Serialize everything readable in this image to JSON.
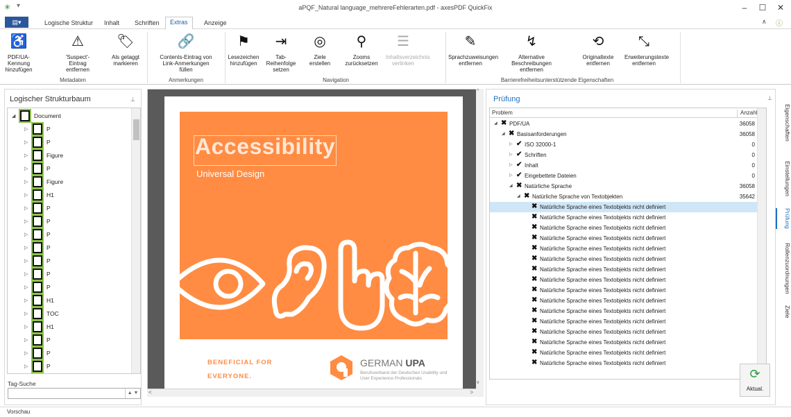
{
  "window": {
    "title": "aPQF_Natural language_mehrereFehlerarten.pdf - axesPDF QuickFix",
    "minimize": "–",
    "maximize": "☐",
    "close": "✕"
  },
  "ribbon_tabs": {
    "file": "▤▾",
    "items": [
      "Logische Struktur",
      "Inhalt",
      "Schriften",
      "Extras",
      "Anzeige"
    ],
    "active": "Extras"
  },
  "ribbon": {
    "buttons": [
      {
        "label": "PDF/UA-Kennung hinzufügen",
        "icon": "accessibility-icon"
      },
      {
        "label": "'Suspect'-Eintrag entfernen",
        "icon": "suspect-remove-icon"
      },
      {
        "label": "Als getaggt markieren",
        "icon": "tag-mark-icon"
      },
      {
        "label": "Contents-Eintrag von Link-Anmerkungen füllen",
        "icon": "link-icon"
      },
      {
        "label": "Lesezeichen hinzufügen",
        "icon": "bookmark-icon"
      },
      {
        "label": "Tab-Reihenfolge setzen",
        "icon": "tab-order-icon"
      },
      {
        "label": "Ziele erstellen",
        "icon": "target-icon"
      },
      {
        "label": "Zooms zurücksetzen",
        "icon": "zoom-icon"
      },
      {
        "label": "Inhaltsverzeichnis verlinken",
        "icon": "toc-link-icon",
        "disabled": true
      },
      {
        "label": "Sprachzuweisungen entfernen",
        "icon": "language-remove-icon"
      },
      {
        "label": "Alternative Beschreibungen entfernen",
        "icon": "alt-remove-icon"
      },
      {
        "label": "Originaltexte entfernen",
        "icon": "original-text-remove-icon"
      },
      {
        "label": "Erweiterungstexte entfernen",
        "icon": "expansion-text-remove-icon"
      }
    ],
    "groups": [
      "Metadaten",
      "Anmerkungen",
      "Navigation",
      "Barrierefreiheitsunterstützende Eigenschaften"
    ]
  },
  "left_panel": {
    "title": "Logischer Strukturbaum",
    "tree": [
      {
        "label": "Document",
        "level": 0,
        "expanded": true
      },
      {
        "label": "P",
        "level": 1
      },
      {
        "label": "P",
        "level": 1
      },
      {
        "label": "Figure",
        "level": 1
      },
      {
        "label": "P",
        "level": 1
      },
      {
        "label": "Figure",
        "level": 1
      },
      {
        "label": "H1",
        "level": 1
      },
      {
        "label": "P",
        "level": 1
      },
      {
        "label": "P",
        "level": 1
      },
      {
        "label": "P",
        "level": 1
      },
      {
        "label": "P",
        "level": 1
      },
      {
        "label": "P",
        "level": 1
      },
      {
        "label": "P",
        "level": 1
      },
      {
        "label": "P",
        "level": 1
      },
      {
        "label": "H1",
        "level": 1
      },
      {
        "label": "TOC",
        "level": 1
      },
      {
        "label": "H1",
        "level": 1
      },
      {
        "label": "P",
        "level": 1
      },
      {
        "label": "P",
        "level": 1
      },
      {
        "label": "P",
        "level": 1
      }
    ],
    "tag_search_label": "Tag-Suche",
    "tag_search_value": ""
  },
  "document": {
    "heading": "Accessibility",
    "subheading": "Universal Design",
    "tagline_1": "BENEFICIAL FOR",
    "tagline_2": "EVERYONE.",
    "brand": "GERMAN",
    "brand_bold": "UPA",
    "brand_sub": "Berufsverband der Deutschen Usability und User Experience Professionals"
  },
  "right_panel": {
    "title": "Prüfung",
    "col_problem": "Problem",
    "col_count": "Anzahl",
    "rows": [
      {
        "label": "PDF/UA",
        "status": "fail",
        "level": 0,
        "count": "36058"
      },
      {
        "label": "Basisanforderungen",
        "status": "fail",
        "level": 1,
        "count": "36058"
      },
      {
        "label": "ISO 32000-1",
        "status": "pass",
        "level": 2,
        "count": "0"
      },
      {
        "label": "Schriften",
        "status": "pass",
        "level": 2,
        "count": "0"
      },
      {
        "label": "Inhalt",
        "status": "pass",
        "level": 2,
        "count": "0"
      },
      {
        "label": "Eingebettete Dateien",
        "status": "pass",
        "level": 2,
        "count": "0"
      },
      {
        "label": "Natürliche Sprache",
        "status": "fail",
        "level": 2,
        "count": "36058"
      },
      {
        "label": "Natürliche Sprache von Textobjekten",
        "status": "fail",
        "level": 3,
        "count": "35642"
      },
      {
        "label": "Natürliche Sprache eines Textobjekts nicht definiert",
        "status": "fail",
        "level": 4,
        "count": "",
        "selected": true
      },
      {
        "label": "Natürliche Sprache eines Textobjekts nicht definiert",
        "status": "fail",
        "level": 4,
        "count": ""
      },
      {
        "label": "Natürliche Sprache eines Textobjekts nicht definiert",
        "status": "fail",
        "level": 4,
        "count": ""
      },
      {
        "label": "Natürliche Sprache eines Textobjekts nicht definiert",
        "status": "fail",
        "level": 4,
        "count": ""
      },
      {
        "label": "Natürliche Sprache eines Textobjekts nicht definiert",
        "status": "fail",
        "level": 4,
        "count": ""
      },
      {
        "label": "Natürliche Sprache eines Textobjekts nicht definiert",
        "status": "fail",
        "level": 4,
        "count": ""
      },
      {
        "label": "Natürliche Sprache eines Textobjekts nicht definiert",
        "status": "fail",
        "level": 4,
        "count": ""
      },
      {
        "label": "Natürliche Sprache eines Textobjekts nicht definiert",
        "status": "fail",
        "level": 4,
        "count": ""
      },
      {
        "label": "Natürliche Sprache eines Textobjekts nicht definiert",
        "status": "fail",
        "level": 4,
        "count": ""
      },
      {
        "label": "Natürliche Sprache eines Textobjekts nicht definiert",
        "status": "fail",
        "level": 4,
        "count": ""
      },
      {
        "label": "Natürliche Sprache eines Textobjekts nicht definiert",
        "status": "fail",
        "level": 4,
        "count": ""
      },
      {
        "label": "Natürliche Sprache eines Textobjekts nicht definiert",
        "status": "fail",
        "level": 4,
        "count": ""
      },
      {
        "label": "Natürliche Sprache eines Textobjekts nicht definiert",
        "status": "fail",
        "level": 4,
        "count": ""
      },
      {
        "label": "Natürliche Sprache eines Textobjekts nicht definiert",
        "status": "fail",
        "level": 4,
        "count": ""
      },
      {
        "label": "Natürliche Sprache eines Textobjekts nicht definiert",
        "status": "fail",
        "level": 4,
        "count": ""
      },
      {
        "label": "Natürliche Sprache eines Textobjekts nicht definiert",
        "status": "fail",
        "level": 4,
        "count": ""
      }
    ],
    "refresh_label": "Aktual."
  },
  "side_tabs": [
    {
      "label": "Eigenschaften"
    },
    {
      "label": "Einstellungen"
    },
    {
      "label": "Prüfung",
      "active": true
    },
    {
      "label": "Rollenzuordnungen"
    },
    {
      "label": "Ziele"
    }
  ],
  "status_bar": {
    "label": "Vorschau"
  },
  "colors": {
    "accent": "#1e6fbf",
    "orange": "#ff8c42",
    "selected": "#cfe6f7",
    "tag_green": "#8bc34a"
  }
}
